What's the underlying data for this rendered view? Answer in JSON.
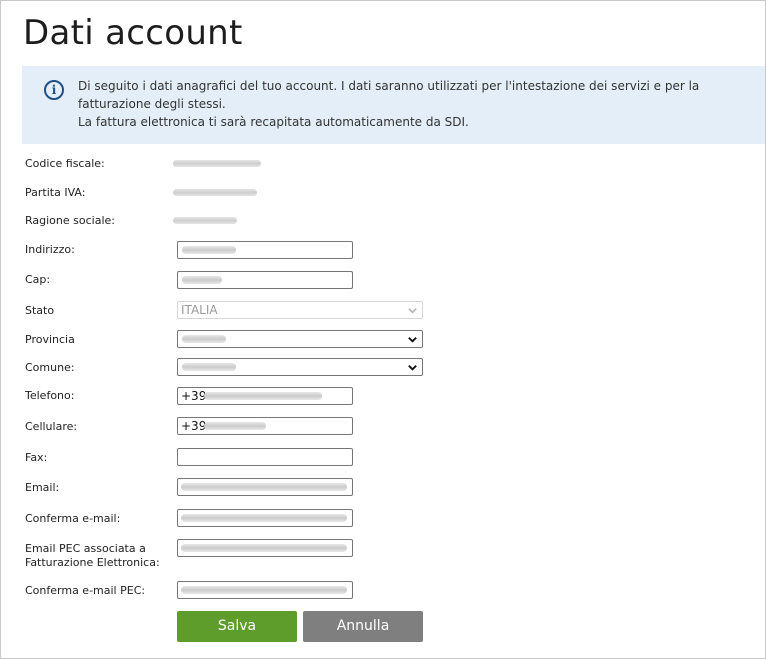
{
  "page": {
    "title": "Dati account"
  },
  "info": {
    "icon": "info-icon",
    "line1": "Di seguito i dati anagrafici del tuo account. I dati saranno utilizzati per l'intestazione dei servizi e per la fatturazione degli stessi.",
    "line2": "La fattura elettronica ti sarà recapitata automaticamente da SDI."
  },
  "fields": {
    "codice_fiscale": {
      "label": "Codice fiscale:"
    },
    "partita_iva": {
      "label": "Partita IVA:"
    },
    "ragione_sociale": {
      "label": "Ragione sociale:"
    },
    "indirizzo": {
      "label": "Indirizzo:"
    },
    "cap": {
      "label": "Cap:"
    },
    "stato": {
      "label": "Stato",
      "value": "ITALIA"
    },
    "provincia": {
      "label": "Provincia"
    },
    "comune": {
      "label": "Comune:"
    },
    "telefono": {
      "label": "Telefono:",
      "prefix": "+39"
    },
    "cellulare": {
      "label": "Cellulare:",
      "prefix": "+39"
    },
    "fax": {
      "label": "Fax:"
    },
    "email": {
      "label": "Email:"
    },
    "conferma_email": {
      "label": "Conferma e-mail:"
    },
    "email_pec_line1": "Email PEC associata a",
    "email_pec_line2": "Fatturazione Elettronica:",
    "conferma_pec": {
      "label": "Conferma e-mail PEC:"
    }
  },
  "buttons": {
    "save": "Salva",
    "cancel": "Annulla"
  },
  "colors": {
    "info_bg": "#e3eef8",
    "info_icon": "#1f4f86",
    "save_bg": "#5e9c2b",
    "cancel_bg": "#7f7f7f"
  }
}
